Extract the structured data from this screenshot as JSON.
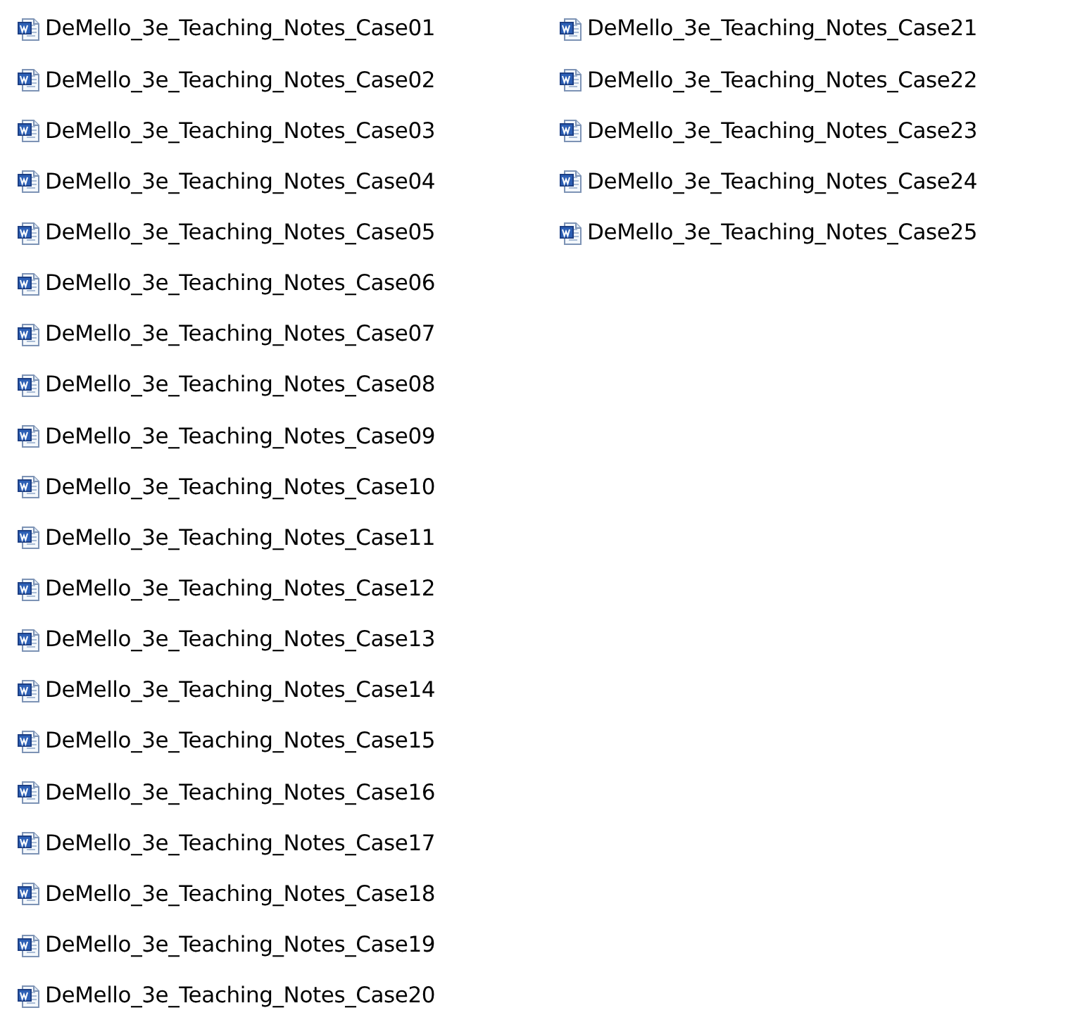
{
  "files": [
    {
      "name": "DeMello_3e_Teaching_Notes_Case01"
    },
    {
      "name": "DeMello_3e_Teaching_Notes_Case02"
    },
    {
      "name": "DeMello_3e_Teaching_Notes_Case03"
    },
    {
      "name": "DeMello_3e_Teaching_Notes_Case04"
    },
    {
      "name": "DeMello_3e_Teaching_Notes_Case05"
    },
    {
      "name": "DeMello_3e_Teaching_Notes_Case06"
    },
    {
      "name": "DeMello_3e_Teaching_Notes_Case07"
    },
    {
      "name": "DeMello_3e_Teaching_Notes_Case08"
    },
    {
      "name": "DeMello_3e_Teaching_Notes_Case09"
    },
    {
      "name": "DeMello_3e_Teaching_Notes_Case10"
    },
    {
      "name": "DeMello_3e_Teaching_Notes_Case11"
    },
    {
      "name": "DeMello_3e_Teaching_Notes_Case12"
    },
    {
      "name": "DeMello_3e_Teaching_Notes_Case13"
    },
    {
      "name": "DeMello_3e_Teaching_Notes_Case14"
    },
    {
      "name": "DeMello_3e_Teaching_Notes_Case15"
    },
    {
      "name": "DeMello_3e_Teaching_Notes_Case16"
    },
    {
      "name": "DeMello_3e_Teaching_Notes_Case17"
    },
    {
      "name": "DeMello_3e_Teaching_Notes_Case18"
    },
    {
      "name": "DeMello_3e_Teaching_Notes_Case19"
    },
    {
      "name": "DeMello_3e_Teaching_Notes_Case20"
    },
    {
      "name": "DeMello_3e_Teaching_Notes_Case21"
    },
    {
      "name": "DeMello_3e_Teaching_Notes_Case22"
    },
    {
      "name": "DeMello_3e_Teaching_Notes_Case23"
    },
    {
      "name": "DeMello_3e_Teaching_Notes_Case24"
    },
    {
      "name": "DeMello_3e_Teaching_Notes_Case25"
    }
  ]
}
